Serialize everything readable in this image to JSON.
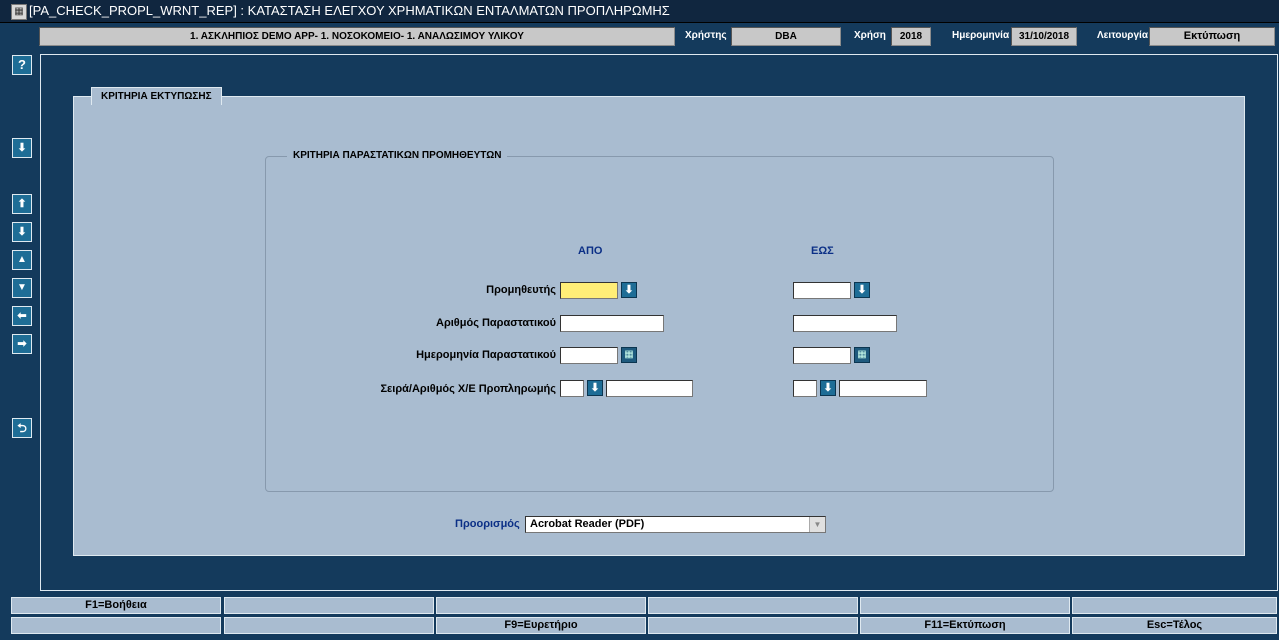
{
  "window": {
    "title": "[PA_CHECK_PROPL_WRNT_REP]  :  ΚΑΤΑΣΤΑΣΗ ΕΛΕΓΧΟΥ ΧΡΗΜΑΤΙΚΩΝ ΕΝΤΑΛΜΑΤΩΝ ΠΡΟΠΛΗΡΩΜΗΣ"
  },
  "header": {
    "organization": "1. ΑΣΚΛΗΠΙΟΣ DEMO APP- 1. ΝΟΣΟΚΟΜΕΙΟ- 1. ΑΝΑΛΩΣΙΜΟΥ ΥΛΙΚΟΥ",
    "user_label": "Χρήστης",
    "user_value": "DBA",
    "year_label": "Χρήση",
    "year_value": "2018",
    "date_label": "Ημερομηνία",
    "date_value": "31/10/2018",
    "mode_label": "Λειτουργία",
    "mode_value": "Εκτύπωση"
  },
  "toolbar": {
    "help": "?",
    "save": "⬇",
    "first": "⬆",
    "last": "⬇",
    "prev": "▲",
    "next": "▼",
    "left": "⬅",
    "right": "➡",
    "back": "⮌"
  },
  "criteria": {
    "tab_label": "ΚΡΙΤΗΡΙΑ ΕΚΤΥΠΩΣΗΣ",
    "group_caption": "ΚΡΙΤΗΡΙΑ ΠΑΡΑΣΤΑΤΙΚΩΝ ΠΡΟΜΗΘΕΥΤΩΝ",
    "from_header": "ΑΠΟ",
    "to_header": "ΕΩΣ",
    "supplier_label": "Προμηθευτής",
    "doc_number_label": "Αριθμός Παραστατικού",
    "doc_date_label": "Ημερομηνία Παραστατικού",
    "series_label": "Σειρά/Αριθμός Χ/Ε Προπληρωμής",
    "supplier_from": "",
    "supplier_to": "",
    "doc_number_from": "",
    "doc_number_to": "",
    "doc_date_from": "",
    "doc_date_to": "",
    "series_from": "",
    "series_number_from": "",
    "series_to": "",
    "series_number_to": ""
  },
  "destination": {
    "label": "Προορισμός",
    "selected": "Acrobat Reader (PDF)"
  },
  "function_keys": {
    "row1": [
      "F1=Βοήθεια",
      "",
      "",
      "",
      "",
      ""
    ],
    "row2": [
      "",
      "",
      "F9=Ευρετήριο",
      "",
      "F11=Εκτύπωση",
      "Esc=Τέλος"
    ]
  }
}
